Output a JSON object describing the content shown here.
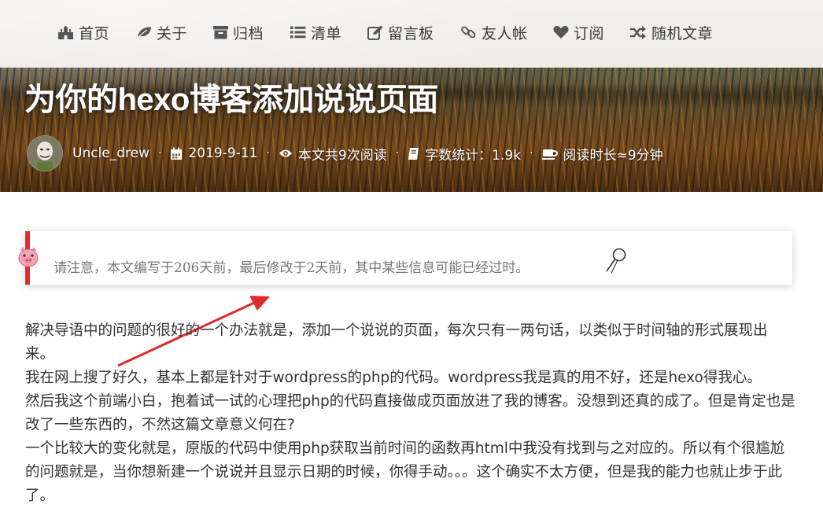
{
  "nav": {
    "items": [
      {
        "label": "首页",
        "icon": "home-icon"
      },
      {
        "label": "关于",
        "icon": "leaf-icon"
      },
      {
        "label": "归档",
        "icon": "archive-icon"
      },
      {
        "label": "清单",
        "icon": "list-icon"
      },
      {
        "label": "留言板",
        "icon": "edit-icon"
      },
      {
        "label": "友人帐",
        "icon": "link-icon"
      },
      {
        "label": "订阅",
        "icon": "heart-icon"
      },
      {
        "label": "随机文章",
        "icon": "shuffle-icon"
      }
    ]
  },
  "post": {
    "title": "为你的hexo博客添加说说页面",
    "author": "Uncle_drew",
    "date": "2019-9-11",
    "views": "本文共9次阅读",
    "word_count": "字数统计：1.9k",
    "read_time": "阅读时长≈9分钟"
  },
  "notice": {
    "text": "请注意，本文编写于206天前，最后修改于2天前，其中某些信息可能已经过时。"
  },
  "article": {
    "paragraphs": [
      "解决导语中的问题的很好的一个办法就是，添加一个说说的页面，每次只有一两句话，以类似于时间轴的形式展现出来。",
      "我在网上搜了好久，基本上都是针对于wordpress的php的代码。wordpress我是真的用不好，还是hexo得我心。",
      "然后我这个前端小白，抱着试一试的心理把php的代码直接做成页面放进了我的博客。没想到还真的成了。但是肯定也是改了一些东西的，不然这篇文章意义何在?",
      "一个比较大的变化就是，原版的代码中使用php获取当前时间的函数再html中我没有找到与之对应的。所以有个很尴尬的问题就是，当你想新建一个说说并且显示日期的时候，你得手动。。。这个确实不太方便，但是我的能力也就止步于此了。"
    ]
  },
  "colors": {
    "accent_border": "#e62b2b",
    "annotation_arrow": "#e02a2a",
    "nav_text": "#3a3a3a",
    "body_text": "#333333"
  }
}
